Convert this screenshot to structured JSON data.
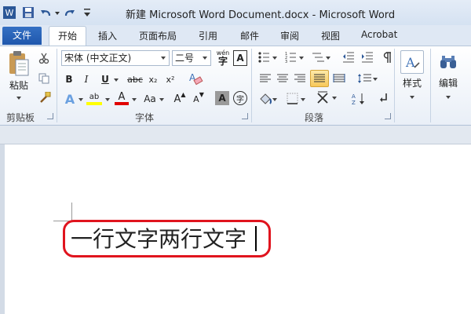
{
  "titlebar": {
    "app_icon": "W",
    "title": "新建 Microsoft Word Document.docx - Microsoft Word",
    "qat_icons": [
      "word-app-icon",
      "save-icon",
      "undo-icon",
      "redo-icon",
      "customize-qat-icon"
    ]
  },
  "tabs": {
    "file": "文件",
    "home": "开始",
    "insert": "插入",
    "page_layout": "页面布局",
    "references": "引用",
    "mailings": "邮件",
    "review": "审阅",
    "view": "视图",
    "acrobat": "Acrobat"
  },
  "ribbon": {
    "clipboard": {
      "label": "剪贴板",
      "paste": "粘贴"
    },
    "font": {
      "label": "字体",
      "font_name": "宋体 (中文正文)",
      "font_size": "二号",
      "phonetic": "wén",
      "border_char": "A",
      "bold": "B",
      "italic": "I",
      "underline": "U",
      "strike": "abc",
      "subscript": "x₂",
      "superscript": "x²",
      "text_effect": "A",
      "highlight": "ab",
      "font_color": "A",
      "change_case": "Aa",
      "grow": "A",
      "shrink": "A",
      "shading": "A",
      "enclose": "字"
    },
    "paragraph": {
      "label": "段落"
    },
    "styles": {
      "label": "样式"
    },
    "editing": {
      "label": "编辑"
    }
  },
  "colors": {
    "file_tab": "#2a64b8",
    "highlight_box": "#e0141e",
    "highlight_yellow": "#ffff00",
    "font_red": "#e00000"
  },
  "document": {
    "text": "一行文字两行文字"
  }
}
